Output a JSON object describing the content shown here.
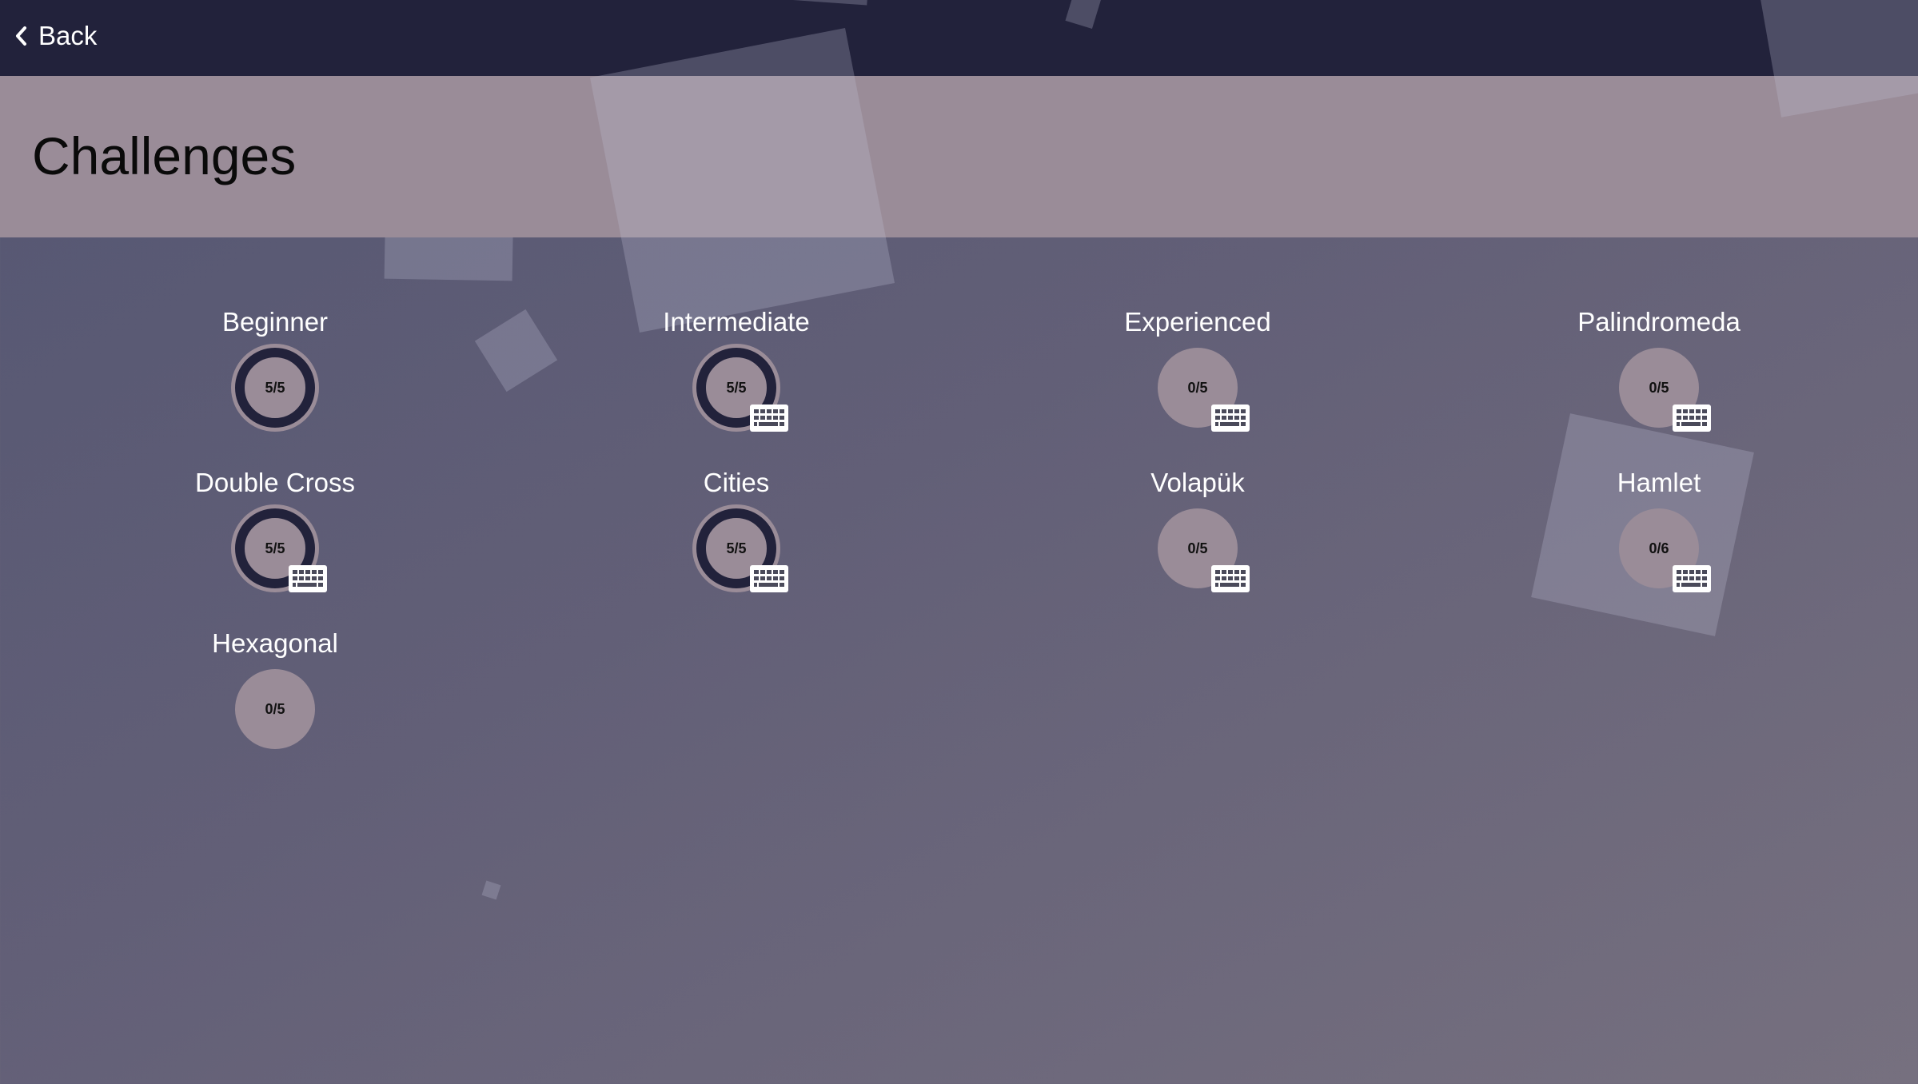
{
  "nav": {
    "back_label": "Back"
  },
  "page": {
    "title": "Challenges"
  },
  "levels": [
    {
      "name": "Beginner",
      "score": "5/5",
      "completed": true,
      "keyboard": false
    },
    {
      "name": "Intermediate",
      "score": "5/5",
      "completed": true,
      "keyboard": true
    },
    {
      "name": "Experienced",
      "score": "0/5",
      "completed": false,
      "keyboard": true
    },
    {
      "name": "Palindromeda",
      "score": "0/5",
      "completed": false,
      "keyboard": true
    },
    {
      "name": "Double Cross",
      "score": "5/5",
      "completed": true,
      "keyboard": true
    },
    {
      "name": "Cities",
      "score": "5/5",
      "completed": true,
      "keyboard": true
    },
    {
      "name": "Volapük",
      "score": "0/5",
      "completed": false,
      "keyboard": true
    },
    {
      "name": "Hamlet",
      "score": "0/6",
      "completed": false,
      "keyboard": true
    },
    {
      "name": "Hexagonal",
      "score": "0/5",
      "completed": false,
      "keyboard": false
    }
  ],
  "icons": {
    "back": "chevron-left-icon",
    "keyboard": "keyboard-icon"
  },
  "colors": {
    "topbar": "#22223b",
    "header": "#9a8c98",
    "circle": "#9a8c98",
    "progress_ring": "#22223b",
    "label": "#ffffff"
  }
}
